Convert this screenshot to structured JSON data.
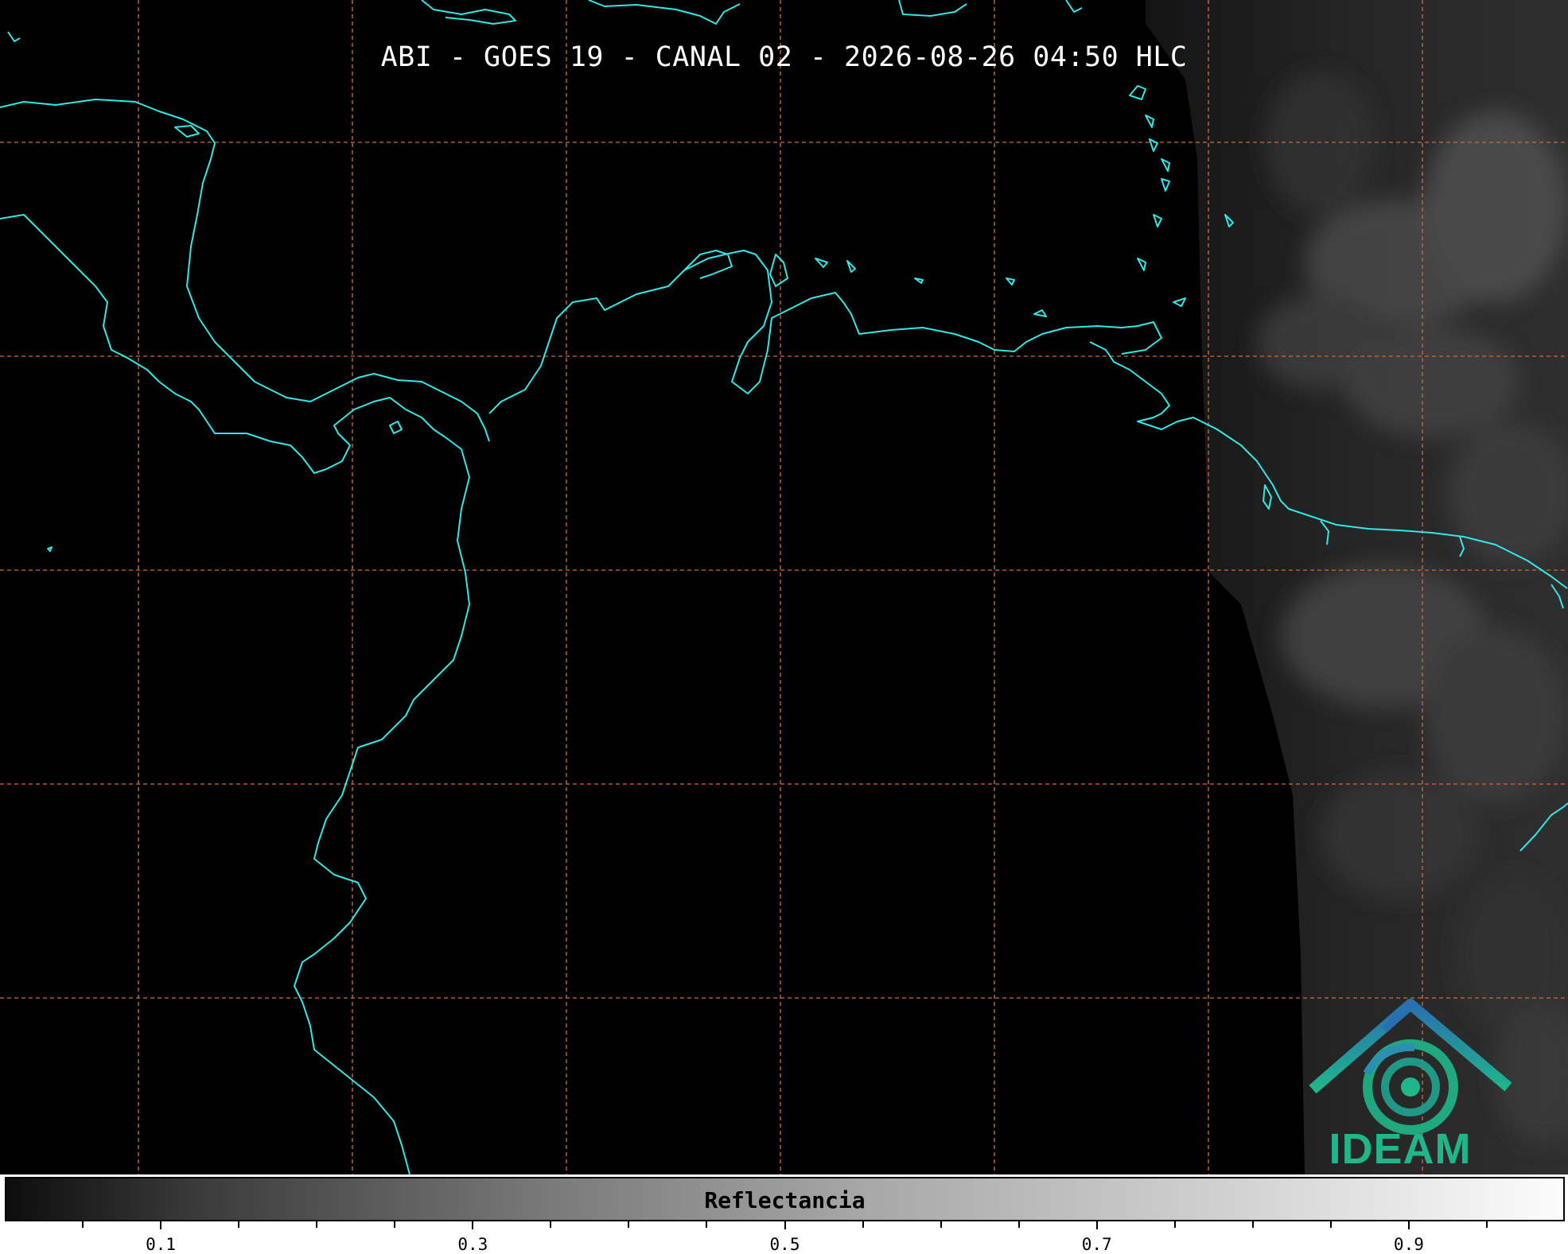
{
  "title": "ABI - GOES 19 - CANAL 02 - 2026-08-26 04:50 HLC",
  "colors": {
    "background": "#000000",
    "coastline": "#2fe8e8",
    "gridline": "#c0683a",
    "logo_blue": "#2a6fb0",
    "logo_green": "#1fb68a"
  },
  "colorbar": {
    "label": "Reflectancia",
    "range": [
      0.0,
      1.0
    ],
    "tick_labels": [
      "0.1",
      "0.3",
      "0.5",
      "0.7",
      "0.9"
    ],
    "tick_values": [
      0.1,
      0.3,
      0.5,
      0.7,
      0.9
    ],
    "minor_tick_step": 0.05
  },
  "logo": {
    "text": "IDEAM",
    "icon": "ideam-swirl-roof-icon"
  },
  "map": {
    "grid": true,
    "features": [
      "coastlines",
      "lat-lon-gridlines",
      "cloud-reflectance-east"
    ]
  }
}
